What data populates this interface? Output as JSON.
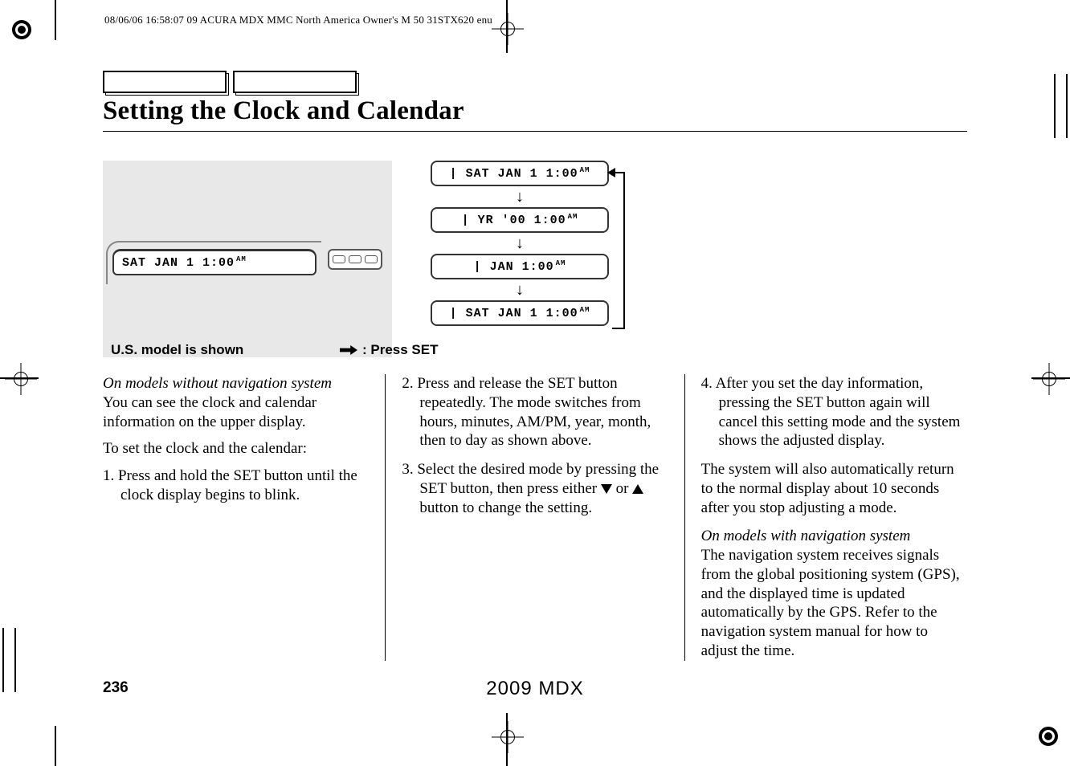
{
  "meta": {
    "header": "08/06/06 16:58:07   09 ACURA MDX MMC North America Owner's M 50 31STX620 enu"
  },
  "title": "Setting the Clock and Calendar",
  "illustration": {
    "main_lcd": "SAT JAN   1  1:00",
    "main_lcd_ampm": "AM",
    "seq": [
      {
        "text": "SAT JAN   1  1:00",
        "ampm": "AM"
      },
      {
        "text": "  YR  '00      1:00",
        "ampm": "AM"
      },
      {
        "text": "      JAN      1:00",
        "ampm": "AM"
      },
      {
        "text": "SAT JAN   1  1:00",
        "ampm": "AM"
      }
    ],
    "note_us": "U.S. model is shown",
    "note_press": ": Press SET"
  },
  "col1": {
    "note": "On models without navigation system",
    "p1": "You can see the clock and calendar information on the upper display.",
    "p2": "To set the clock and the calendar:",
    "step1_num": "1. ",
    "step1": "Press and hold the SET button until the clock display begins to blink."
  },
  "col2": {
    "step2_num": "2. ",
    "step2": "Press and release the SET button repeatedly. The mode switches from hours, minutes, AM/PM, year, month, then to day as shown above.",
    "step3_num": "3. ",
    "step3a": "Select the desired mode by pressing the SET button, then press either ",
    "step3b": " or ",
    "step3c": " button to change the setting."
  },
  "col3": {
    "step4_num": "4. ",
    "step4": "After you set the day information, pressing the SET button again will cancel this setting mode and the system shows the adjusted display.",
    "p1": "The system will also automatically return to the normal display about 10 seconds after you stop adjusting a mode.",
    "note": "On models with navigation system",
    "p2": "The navigation system receives signals from the global positioning system (GPS), and the displayed time is updated automatically by the GPS. Refer to the navigation system manual for how to adjust the time."
  },
  "footer": {
    "page": "236",
    "model": "2009  MDX"
  }
}
